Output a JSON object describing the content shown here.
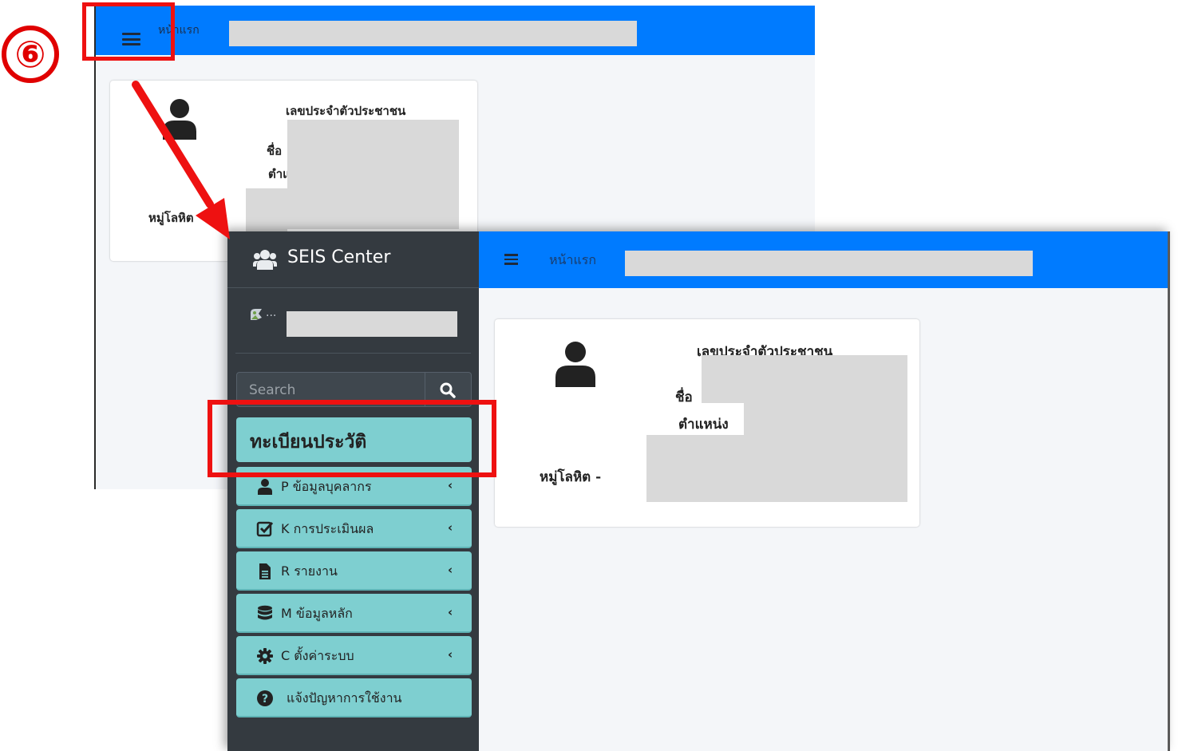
{
  "step_number": "⑥",
  "app": {
    "brand": "SEIS Center",
    "nav": {
      "home_label": "หน้าแรก"
    },
    "search": {
      "placeholder": "Search"
    },
    "sidebar": {
      "title": "ทะเบียนประวัติ",
      "items": [
        {
          "code": "P",
          "label": "P ข้อมูลบุคลากร",
          "icon": "user-icon",
          "chevron": "‹"
        },
        {
          "code": "K",
          "label": "K การประเมินผล",
          "icon": "check-square-icon",
          "chevron": "‹"
        },
        {
          "code": "R",
          "label": "R รายงาน",
          "icon": "file-icon",
          "chevron": "‹"
        },
        {
          "code": "M",
          "label": "M ข้อมูลหลัก",
          "icon": "database-icon",
          "chevron": "‹"
        },
        {
          "code": "C",
          "label": "C ตั้งค่าระบบ",
          "icon": "gear-icon",
          "chevron": "‹"
        },
        {
          "label": "แจ้งปัญหาการใช้งาน",
          "icon": "question-circle-icon"
        }
      ]
    },
    "profile_card": {
      "citizen_id_label": "เลขประจำตัวประชาชน",
      "name_label": "ชื่อ",
      "position_label": "ตำแหน่ง",
      "blood_label": "หมู่โลหิต -",
      "blood_label_partial": "หมู่โลหิต"
    },
    "user_image_alt": "..."
  },
  "colors": {
    "navbar": "#007bff",
    "sidebar": "#343a40",
    "menu_item": "#7ecfd0",
    "annotation": "#ee1111"
  }
}
